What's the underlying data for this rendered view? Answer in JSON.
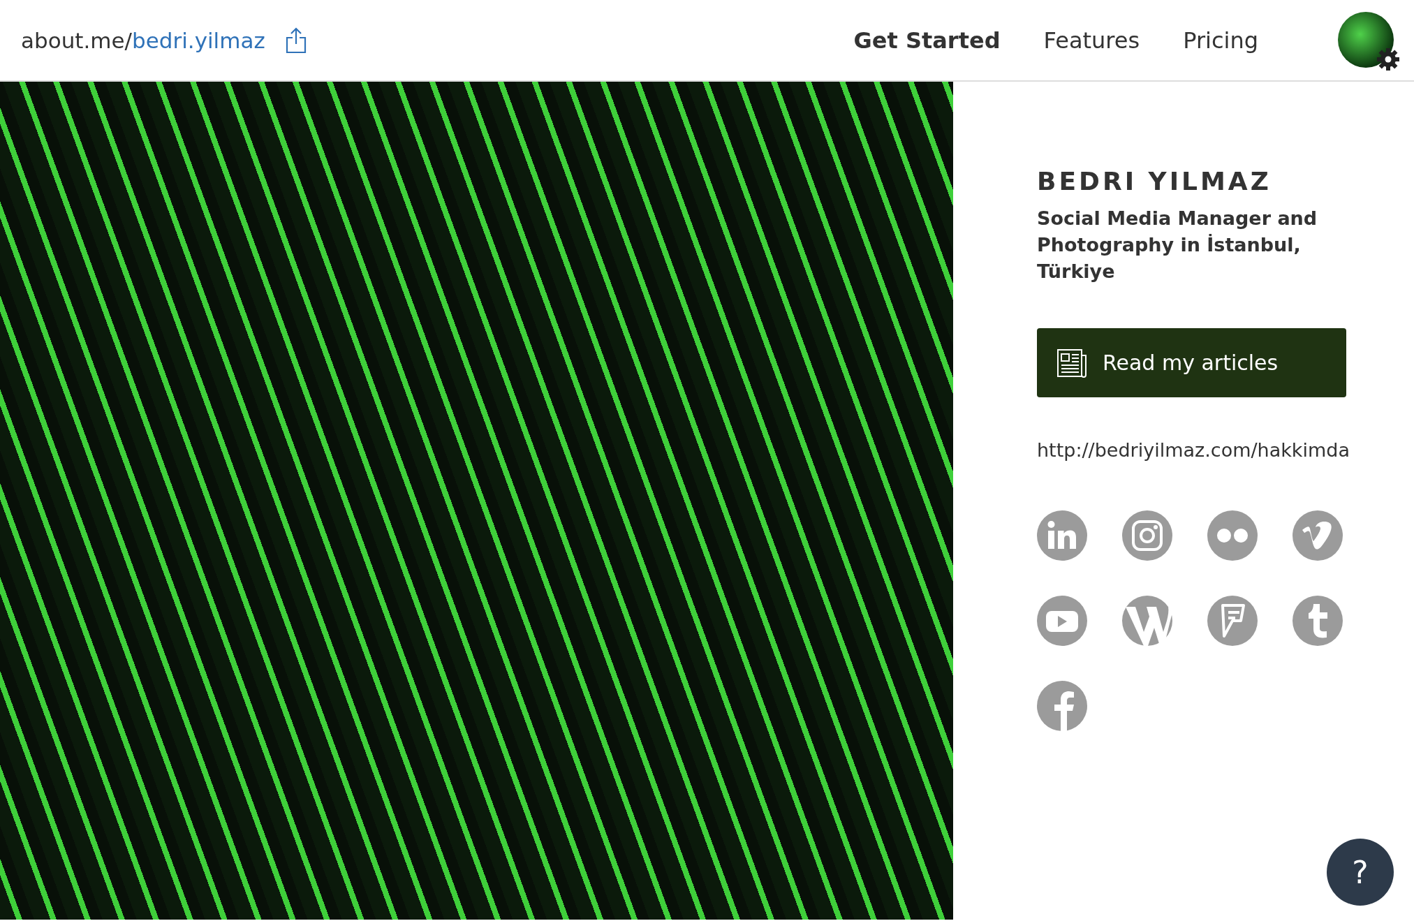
{
  "header": {
    "site": "about.me/",
    "username": "bedri.yilmaz",
    "nav": [
      {
        "label": "Get Started",
        "kind": "cta"
      },
      {
        "label": "Features",
        "kind": "link"
      },
      {
        "label": "Pricing",
        "kind": "link"
      }
    ]
  },
  "profile": {
    "name": "BEDRI YILMAZ",
    "headline": "Social Media Manager and Photography in İstanbul, Türkiye",
    "button": "Read my articles",
    "url": "http://bedriyilmaz.com/hakkimda",
    "social": [
      {
        "kind": "linkedin"
      },
      {
        "kind": "instagram"
      },
      {
        "kind": "flickr"
      },
      {
        "kind": "vimeo"
      },
      {
        "kind": "youtube"
      },
      {
        "kind": "wordpress"
      },
      {
        "kind": "foursquare"
      },
      {
        "kind": "tumblr"
      },
      {
        "kind": "facebook"
      }
    ]
  },
  "help": {
    "label": "?"
  }
}
